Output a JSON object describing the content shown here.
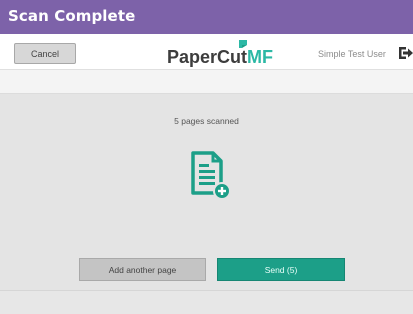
{
  "window": {
    "title": "Scan Complete"
  },
  "header": {
    "cancel_label": "Cancel",
    "logo": {
      "paper": "PaperCut",
      "mf": "MF"
    },
    "user_name": "Simple Test User"
  },
  "main": {
    "status_text": "5 pages scanned",
    "add_page_label": "Add another page",
    "send_label": "Send (5)"
  },
  "colors": {
    "title_bar": "#7d62a9",
    "accent": "#1c9f88",
    "icon_teal": "#2cb8a5"
  },
  "icons": [
    "document-add-icon",
    "logout-icon",
    "logo-flag-icon"
  ]
}
